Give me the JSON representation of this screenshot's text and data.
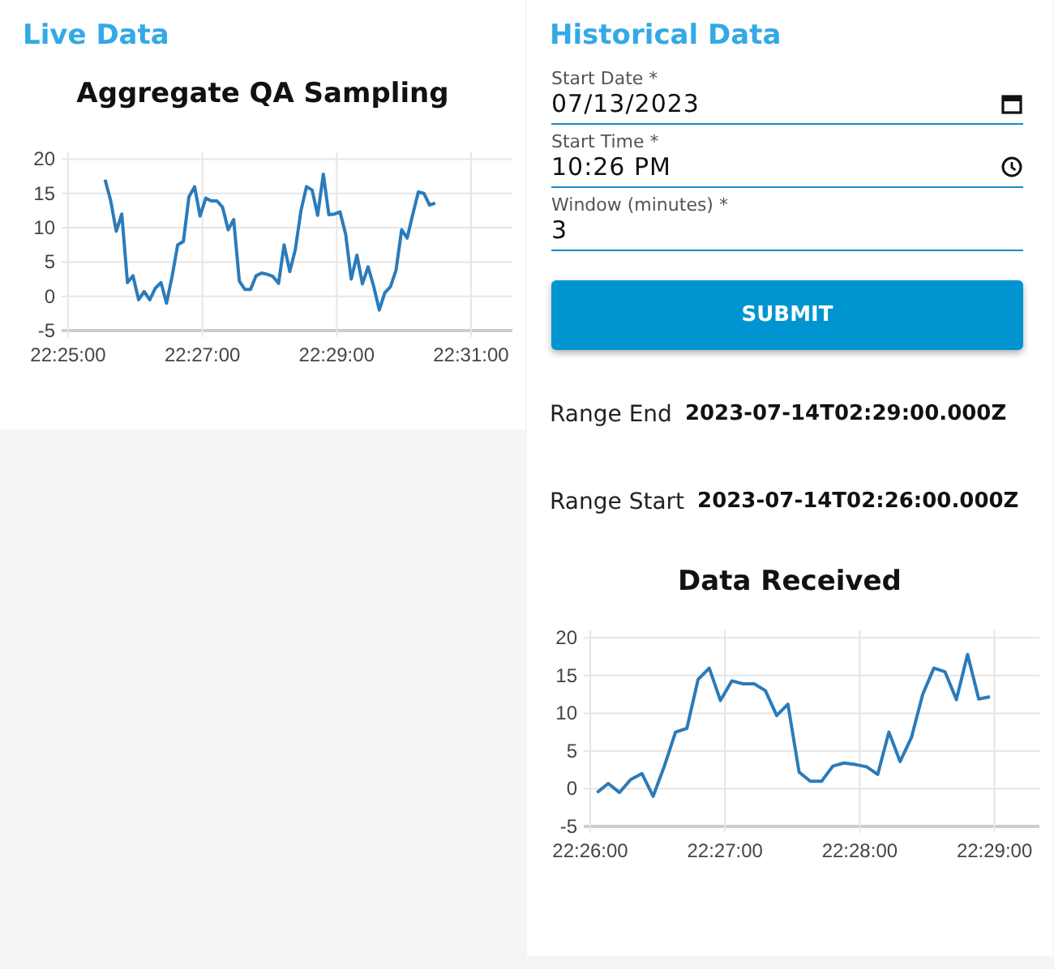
{
  "live": {
    "heading": "Live Data",
    "chart_data": {
      "type": "line",
      "title": "Aggregate QA Sampling",
      "x": [
        80733,
        80738,
        80743,
        80748,
        80753,
        80758,
        80763,
        80768,
        80773,
        80778,
        80783,
        80788,
        80793,
        80798,
        80803,
        80808,
        80813,
        80818,
        80823,
        80828,
        80833,
        80838,
        80843,
        80848,
        80853,
        80858,
        80863,
        80868,
        80873,
        80878,
        80883,
        80888,
        80893,
        80898,
        80903,
        80908,
        80913,
        80918,
        80923,
        80928,
        80933,
        80938,
        80943,
        80948,
        80953,
        80958,
        80963,
        80968,
        80973,
        80978,
        80983,
        80988,
        80993,
        80998,
        81003,
        81008,
        81013,
        81018,
        81023,
        81028
      ],
      "series": [
        {
          "color": "#2b7bba",
          "values": [
            17,
            14,
            9.5,
            12,
            2,
            3,
            -0.5,
            0.7,
            -0.5,
            1.2,
            2,
            -1,
            3,
            7.5,
            8,
            14.5,
            16,
            11.7,
            14.3,
            13.9,
            13.9,
            13,
            9.7,
            11.2,
            2.2,
            1,
            1,
            3,
            3.4,
            3.2,
            2.9,
            1.9,
            7.5,
            3.6,
            6.8,
            12.5,
            16,
            15.5,
            11.8,
            17.8,
            11.9,
            12,
            12.3,
            9,
            2.5,
            6,
            1.8,
            4.3,
            1.5,
            -2,
            0.5,
            1.4,
            3.8,
            9.7,
            8.5,
            12,
            15.2,
            15,
            13.3,
            13.6
          ]
        }
      ],
      "xlim": [
        80700,
        81097
      ],
      "ylim": [
        -5,
        21
      ],
      "grid": true,
      "xticks": [
        {
          "value": 80700,
          "label": "22:25:00"
        },
        {
          "value": 80820,
          "label": "22:27:00"
        },
        {
          "value": 80940,
          "label": "22:29:00"
        },
        {
          "value": 81060,
          "label": "22:31:00"
        }
      ],
      "yticks": [
        -5,
        0,
        5,
        10,
        15,
        20
      ]
    }
  },
  "historical": {
    "heading": "Historical Data",
    "fields": [
      {
        "label": "Start Date",
        "required_mark": "*",
        "value": "07/13/2023",
        "kind": "date"
      },
      {
        "label": "Start Time",
        "required_mark": "*",
        "value": "10:26 PM",
        "kind": "time"
      },
      {
        "label": "Window (minutes)",
        "required_mark": "*",
        "value": "3",
        "kind": "number"
      }
    ],
    "submit": "SUBMIT",
    "ranges": [
      {
        "label": "Range End",
        "value": "2023-07-14T02:29:00.000Z"
      },
      {
        "label": "Range Start",
        "value": "2023-07-14T02:26:00.000Z"
      }
    ],
    "chart_data": {
      "type": "line",
      "title": "Data Received",
      "x": [
        80763,
        80768,
        80773,
        80778,
        80783,
        80788,
        80793,
        80798,
        80803,
        80808,
        80813,
        80818,
        80823,
        80828,
        80833,
        80838,
        80843,
        80848,
        80853,
        80858,
        80863,
        80868,
        80873,
        80878,
        80883,
        80888,
        80893,
        80898,
        80903,
        80908,
        80913,
        80918,
        80923,
        80928,
        80933,
        80938
      ],
      "series": [
        {
          "color": "#2b7bba",
          "values": [
            -0.5,
            0.7,
            -0.5,
            1.2,
            2,
            -1,
            3,
            7.5,
            8,
            14.5,
            16,
            11.7,
            14.3,
            13.9,
            13.9,
            13,
            9.7,
            11.2,
            2.2,
            1,
            1,
            3,
            3.4,
            3.2,
            2.9,
            1.9,
            7.5,
            3.6,
            6.8,
            12.5,
            16,
            15.5,
            11.8,
            17.8,
            11.9,
            12.2
          ]
        }
      ],
      "xlim": [
        80760,
        80960
      ],
      "ylim": [
        -5,
        21
      ],
      "grid": true,
      "xticks": [
        {
          "value": 80760,
          "label": "22:26:00"
        },
        {
          "value": 80820,
          "label": "22:27:00"
        },
        {
          "value": 80880,
          "label": "22:28:00"
        },
        {
          "value": 80940,
          "label": "22:29:00"
        }
      ],
      "yticks": [
        -5,
        0,
        5,
        10,
        15,
        20
      ]
    }
  }
}
